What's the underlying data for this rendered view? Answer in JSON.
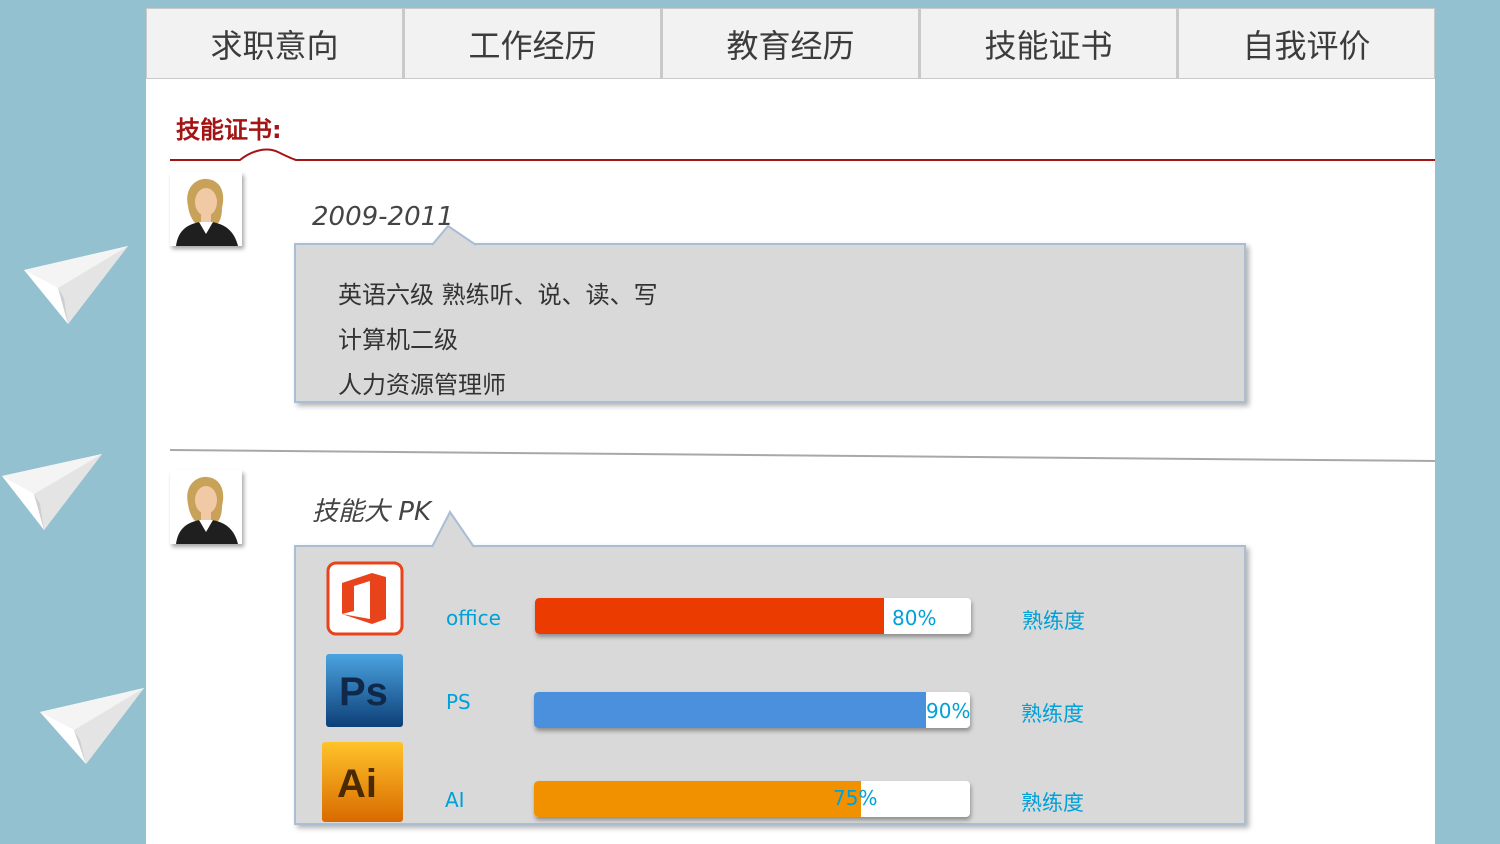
{
  "tabs": [
    {
      "label": "求职意向"
    },
    {
      "label": "工作经历"
    },
    {
      "label": "教育经历"
    },
    {
      "label": "技能证书"
    },
    {
      "label": "自我评价"
    }
  ],
  "section": {
    "title": "技能证书:"
  },
  "certificates": {
    "period": "2009-2011",
    "items": [
      "英语六级   熟练听、说、读、写",
      "计算机二级",
      "人力资源管理师"
    ]
  },
  "skills": {
    "heading": "技能大 PK",
    "proficiency_label": "熟练度",
    "items": [
      {
        "name": "office",
        "percent": 80,
        "percent_label": "80%",
        "color": "#eb3b00",
        "icon": "office-icon"
      },
      {
        "name": "PS",
        "percent": 90,
        "percent_label": "90%",
        "color": "#4a90dc",
        "icon": "photoshop-icon"
      },
      {
        "name": "AI",
        "percent": 75,
        "percent_label": "75%",
        "color": "#f29100",
        "icon": "illustrator-icon"
      }
    ]
  },
  "colors": {
    "accent": "#a31515",
    "background": "#93c1d0",
    "skill_text": "#00a0d8"
  }
}
